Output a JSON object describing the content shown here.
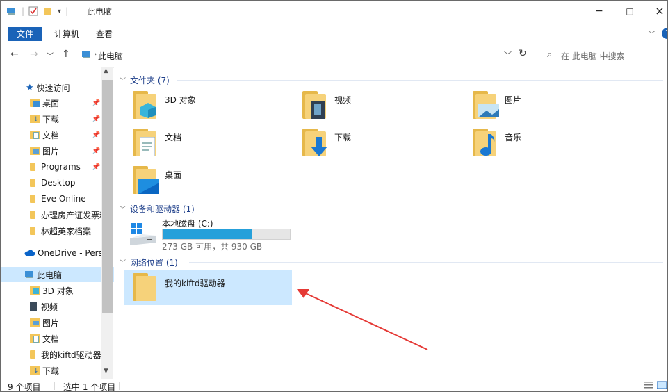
{
  "window": {
    "title": "此电脑",
    "minimize": "−",
    "maximize": "□",
    "close": "×"
  },
  "ribbon": {
    "file_tab": "文件",
    "tabs": [
      "计算机",
      "查看"
    ]
  },
  "address": {
    "path": "此电脑",
    "search_placeholder": "在 此电脑 中搜索"
  },
  "sidebar": {
    "quick_access": "快速访问",
    "quick_items": [
      "桌面",
      "下载",
      "文档",
      "图片",
      "Programs",
      "Desktop",
      "Eve Online",
      "办理房产证发票粘",
      "林超英家档案"
    ],
    "onedrive": "OneDrive - Perso",
    "this_pc": "此电脑",
    "pc_items": [
      "3D 对象",
      "视频",
      "图片",
      "文档",
      "我的kiftd驱动器",
      "下载"
    ]
  },
  "main": {
    "folders_header": "文件夹 (7)",
    "folders": [
      "3D 对象",
      "视频",
      "图片",
      "文档",
      "下载",
      "音乐",
      "桌面"
    ],
    "devices_header": "设备和驱动器 (1)",
    "drive": {
      "name": "本地磁盘 (C:)",
      "space": "273 GB 可用，共 930 GB",
      "used_fraction": 0.706
    },
    "network_header": "网络位置 (1)",
    "network_item": "我的kiftd驱动器"
  },
  "status": {
    "items": "9 个项目",
    "selected": "选中 1 个项目"
  },
  "colors": {
    "accent": "#1a63b8",
    "selection": "#cce8ff",
    "folder": "#f3c65a",
    "drive_bar": "#26a0da",
    "arrow": "#e53935"
  }
}
